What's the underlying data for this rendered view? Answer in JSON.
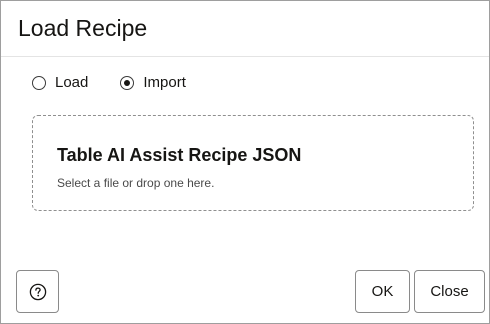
{
  "dialog": {
    "title": "Load Recipe"
  },
  "source_options": {
    "selected": "Import",
    "options": [
      {
        "label": "Load",
        "checked": false
      },
      {
        "label": "Import",
        "checked": true
      }
    ]
  },
  "dropzone": {
    "title": "Table AI Assist Recipe JSON",
    "hint": "Select a file or drop one here."
  },
  "footer": {
    "help_icon": "help-icon",
    "ok_label": "OK",
    "close_label": "Close"
  }
}
